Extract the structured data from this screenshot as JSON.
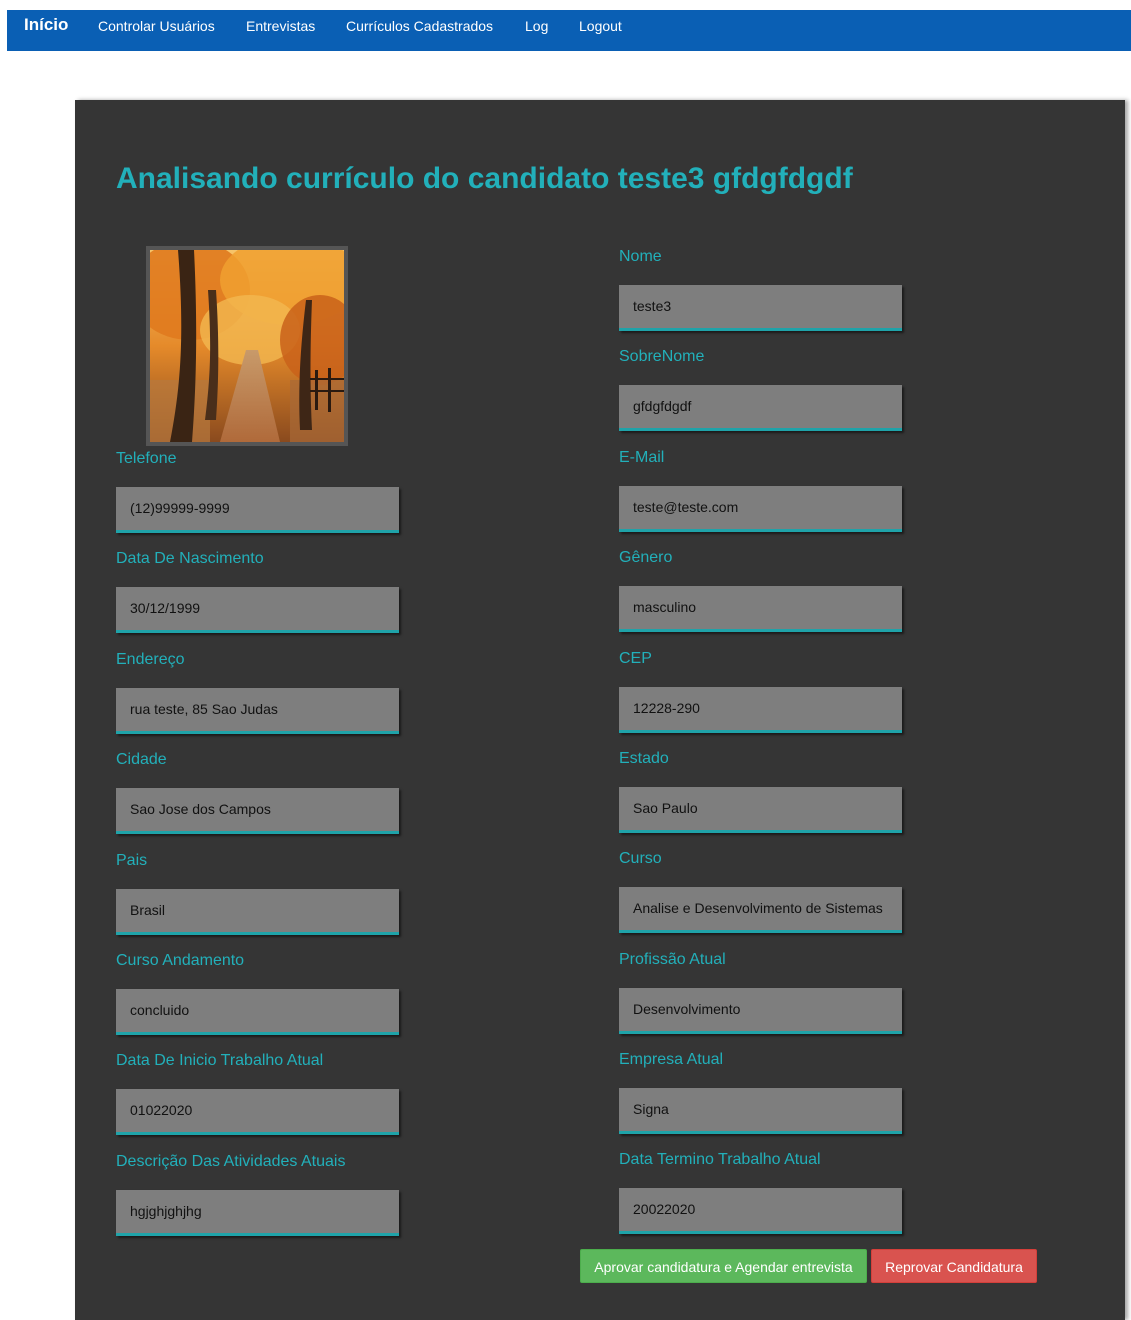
{
  "nav": {
    "brand": "Início",
    "items": [
      {
        "label": "Controlar Usuários",
        "name": "nav-controlar-usuarios"
      },
      {
        "label": "Entrevistas",
        "name": "nav-entrevistas"
      },
      {
        "label": "Currículos Cadastrados",
        "name": "nav-curriculos-cadastrados"
      },
      {
        "label": "Log",
        "name": "nav-log"
      },
      {
        "label": "Logout",
        "name": "nav-logout"
      }
    ]
  },
  "page": {
    "title": "Analisando currículo do candidato teste3 gfdgfdgdf"
  },
  "fields": {
    "nome": {
      "label": "Nome",
      "value": "teste3"
    },
    "sobrenome": {
      "label": "SobreNome",
      "value": "gfdgfdgdf"
    },
    "telefone": {
      "label": "Telefone",
      "value": "(12)99999-9999"
    },
    "email": {
      "label": "E-Mail",
      "value": "teste@teste.com"
    },
    "data_nascimento": {
      "label": "Data De Nascimento",
      "value": "30/12/1999"
    },
    "genero": {
      "label": "Gênero",
      "value": "masculino"
    },
    "endereco": {
      "label": "Endereço",
      "value": "rua teste, 85 Sao Judas"
    },
    "cep": {
      "label": "CEP",
      "value": "12228-290"
    },
    "cidade": {
      "label": "Cidade",
      "value": "Sao Jose dos Campos"
    },
    "estado": {
      "label": "Estado",
      "value": "Sao Paulo"
    },
    "pais": {
      "label": "Pais",
      "value": "Brasil"
    },
    "curso": {
      "label": "Curso",
      "value": "Analise e Desenvolvimento de Sistemas"
    },
    "curso_andamento": {
      "label": "Curso Andamento",
      "value": "concluido"
    },
    "profissao_atual": {
      "label": "Profissão Atual",
      "value": "Desenvolvimento"
    },
    "data_inicio_trabalho": {
      "label": "Data De Inicio Trabalho Atual",
      "value": "01022020"
    },
    "empresa_atual": {
      "label": "Empresa Atual",
      "value": "Signa"
    },
    "descricao_atividades": {
      "label": "Descrição Das Atividades Atuais",
      "value": "hgjghjghjhg"
    },
    "data_termino_trabalho": {
      "label": "Data Termino Trabalho Atual",
      "value": "20022020"
    }
  },
  "actions": {
    "approve_label": "Aprovar candidatura e Agendar entrevista",
    "reject_label": "Reprovar Candidatura"
  },
  "colors": {
    "navbar": "#0a5fb4",
    "panel": "#353535",
    "accent": "#22b0ba",
    "approve": "#5cb85c",
    "reject": "#d9534f"
  }
}
